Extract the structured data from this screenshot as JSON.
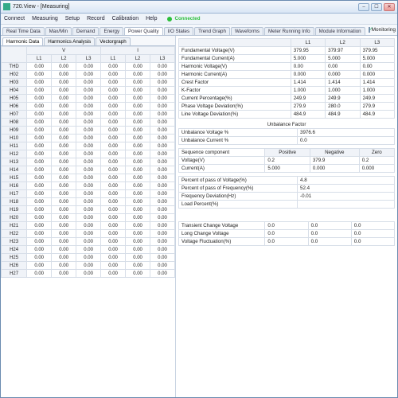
{
  "title": "720.View - [Measuring]",
  "menu": [
    "Connect",
    "Measuring",
    "Setup",
    "Record",
    "Calibration",
    "Help"
  ],
  "status": {
    "connected": "Connected",
    "monitoring": "Monitoring"
  },
  "mainTabs": [
    "Real Time Data",
    "Max/Min",
    "Demand",
    "Energy",
    "Power Quality",
    "I/O States",
    "Trend Graph",
    "Waveforms",
    "Meter Running Info",
    "Module Information"
  ],
  "mainTabActive": 4,
  "subTabs": [
    "Harmonic Data",
    "Harmonics Analysis",
    "Vectorgraph"
  ],
  "subTabActive": 0,
  "harmHeader": {
    "groups": [
      "V",
      "I"
    ],
    "cols": [
      "L1",
      "L2",
      "L3",
      "L1",
      "L2",
      "L3"
    ]
  },
  "harmRows": [
    "THD",
    "H02",
    "H03",
    "H04",
    "H05",
    "H06",
    "H07",
    "H08",
    "H09",
    "H10",
    "H11",
    "H12",
    "H13",
    "H14",
    "H15",
    "H16",
    "H17",
    "H18",
    "H19",
    "H20",
    "H21",
    "H22",
    "H23",
    "H24",
    "H25",
    "H26",
    "H27"
  ],
  "harmCell": "0.00",
  "fund": {
    "cols": [
      "L1",
      "L2",
      "L3"
    ],
    "rows": [
      {
        "label": "Fundamental Voltage(V)",
        "v": [
          "379.95",
          "379.97",
          "379.95"
        ]
      },
      {
        "label": "Fundamental Current(A)",
        "v": [
          "5.000",
          "5.000",
          "5.000"
        ]
      },
      {
        "label": "Harmonic Voltage(V)",
        "v": [
          "0.00",
          "0.00",
          "0.00"
        ]
      },
      {
        "label": "Harmonic Current(A)",
        "v": [
          "0.000",
          "0.000",
          "0.000"
        ]
      },
      {
        "label": "Crest Factor",
        "v": [
          "1.414",
          "1.414",
          "1.414"
        ]
      },
      {
        "label": "K-Factor",
        "v": [
          "1.000",
          "1.000",
          "1.000"
        ]
      },
      {
        "label": "Current Percentage(%)",
        "v": [
          "249.9",
          "249.9",
          "249.9"
        ]
      },
      {
        "label": "Phase Voltage Deviation(%)",
        "v": [
          "279.9",
          "280.0",
          "279.9"
        ]
      },
      {
        "label": "Line Voltage Deviation(%)",
        "v": [
          "484.9",
          "484.9",
          "484.9"
        ]
      }
    ]
  },
  "unbalance": {
    "title": "Unbalance Factor",
    "rows": [
      {
        "label": "Unbalance Voltage %",
        "val": "3976.6"
      },
      {
        "label": "Unbalance Current %",
        "val": "0.0"
      }
    ],
    "seqLabel": "Sequence component",
    "seqCols": [
      "Positive",
      "Negative",
      "Zero"
    ],
    "seqRows": [
      {
        "label": "Voltage(V)",
        "v": [
          "0.2",
          "379.9",
          "0.2"
        ]
      },
      {
        "label": "Current(A)",
        "v": [
          "5.000",
          "0.000",
          "0.000"
        ]
      }
    ]
  },
  "freq": [
    {
      "label": "Percent of pass of Voltage(%)",
      "val": "4.8"
    },
    {
      "label": "Percent of pass of Frequency(%)",
      "val": "52.4"
    },
    {
      "label": "Frequency Deviation(Hz)",
      "val": "-0.01"
    },
    {
      "label": "Load Percent(%)",
      "val": ""
    }
  ],
  "volt": {
    "rows": [
      {
        "label": "Transient Change Voltage",
        "v": [
          "0.0",
          "0.0",
          "0.0"
        ]
      },
      {
        "label": "Long Change Voltage",
        "v": [
          "0.0",
          "0.0",
          "0.0"
        ]
      },
      {
        "label": "Voltage Fluctuation(%)",
        "v": [
          "0.0",
          "0.0",
          "0.0"
        ]
      }
    ]
  }
}
